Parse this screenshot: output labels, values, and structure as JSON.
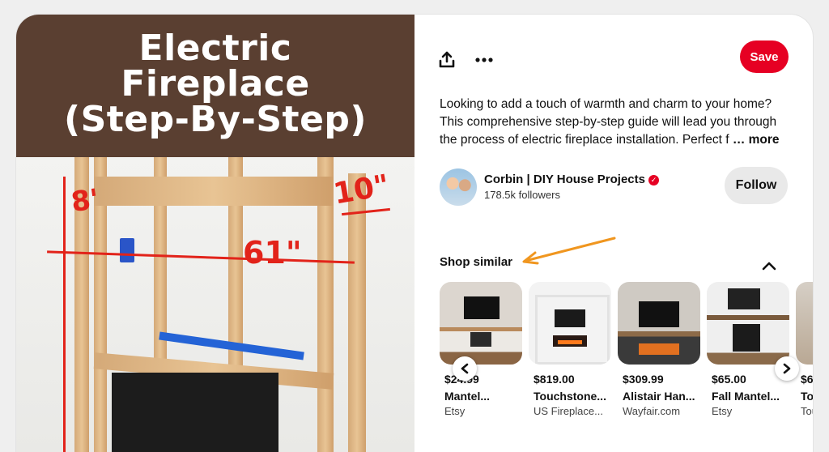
{
  "pin": {
    "title_lines": [
      "Electric",
      "Fireplace",
      "(Step-By-Step)"
    ],
    "dimensions": [
      "8'",
      "10\"",
      "61\""
    ]
  },
  "actions": {
    "share_icon": "share-icon",
    "more_icon": "more-icon",
    "save_label": "Save"
  },
  "description": {
    "text": "Looking to add a touch of warmth and charm to your home? This comprehensive step-by-step guide will lead you through the process of electric fireplace installation. Perfect f",
    "more_label": "… more"
  },
  "creator": {
    "name": "Corbin | DIY House Projects",
    "followers": "178.5k followers",
    "follow_label": "Follow"
  },
  "shop": {
    "title": "Shop similar",
    "products": [
      {
        "price": "$24.99",
        "name": "Mantel...",
        "store": "Etsy"
      },
      {
        "price": "$819.00",
        "name": "Touchstone...",
        "store": "US Fireplace..."
      },
      {
        "price": "$309.99",
        "name": "Alistair Han...",
        "store": "Wayfair.com"
      },
      {
        "price": "$65.00",
        "name": "Fall Mantel...",
        "store": "Etsy"
      },
      {
        "price": "$6",
        "name": "Tou",
        "store": "Tou"
      }
    ]
  },
  "colors": {
    "save": "#e60023",
    "title_band": "#5a3f31",
    "annotation_arrow": "#f0961f"
  }
}
